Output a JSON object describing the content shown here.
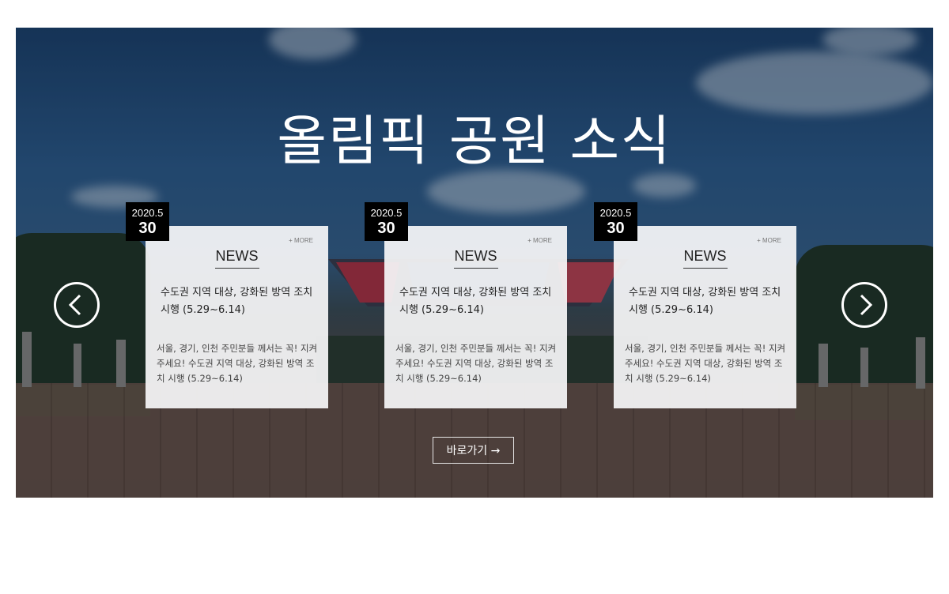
{
  "section": {
    "title": "올림픽 공원 소식"
  },
  "cards": [
    {
      "date_ym": "2020.5",
      "date_day": "30",
      "more": "+ MORE",
      "label": "NEWS",
      "headline": "수도권 지역 대상, 강화된 방역 조치 시행 (5.29~6.14)",
      "body": "서울, 경기, 인천 주민분들 께서는 꼭! 지켜주세요! 수도권 지역 대상, 강화된 방역 조치 시행 (5.29~6.14)"
    },
    {
      "date_ym": "2020.5",
      "date_day": "30",
      "more": "+ MORE",
      "label": "NEWS",
      "headline": "수도권 지역 대상, 강화된 방역 조치 시행 (5.29~6.14)",
      "body": "서울, 경기, 인천 주민분들 께서는 꼭! 지켜주세요! 수도권 지역 대상, 강화된 방역 조치 시행 (5.29~6.14)"
    },
    {
      "date_ym": "2020.5",
      "date_day": "30",
      "more": "+ MORE",
      "label": "NEWS",
      "headline": "수도권 지역 대상, 강화된 방역 조치 시행 (5.29~6.14)",
      "body": "서울, 경기, 인천 주민분들 께서는 꼭! 지켜주세요! 수도권 지역 대상, 강화된 방역 조치 시행 (5.29~6.14)"
    }
  ],
  "navigation": {
    "prev_icon": "chevron-left-icon",
    "next_icon": "chevron-right-icon"
  },
  "button": {
    "label": "바로가기 →"
  }
}
